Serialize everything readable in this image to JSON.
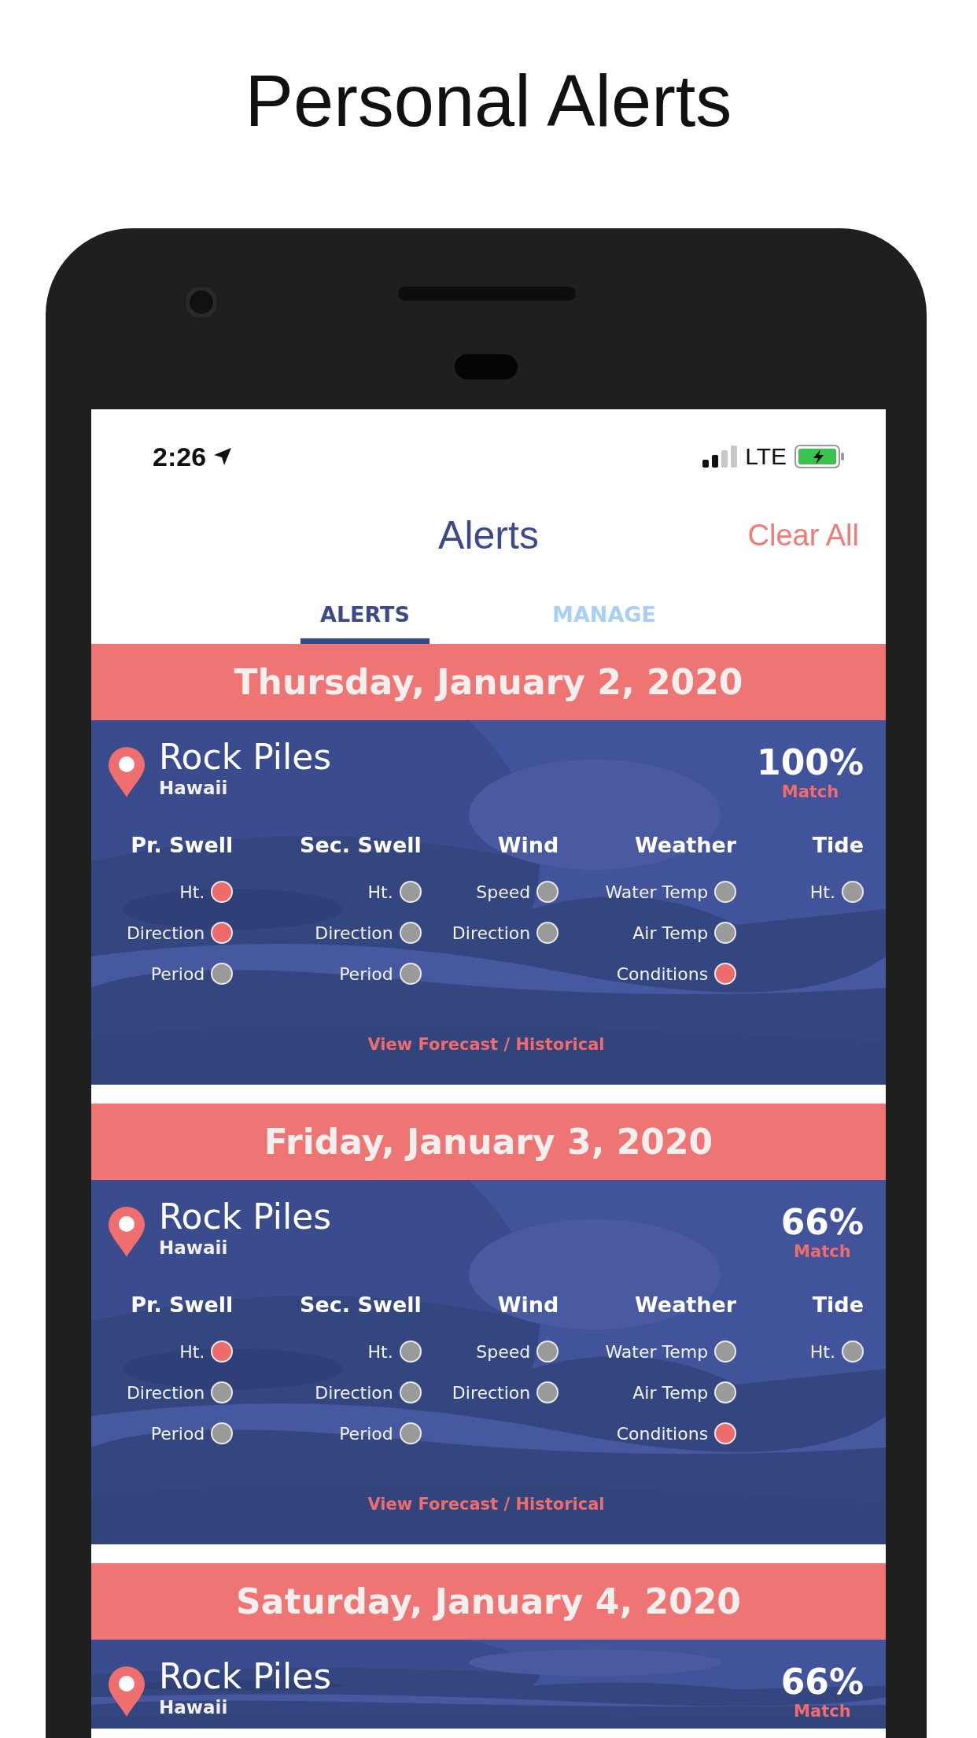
{
  "headline": "Personal Alerts",
  "status_bar": {
    "time": "2:26",
    "network": "LTE"
  },
  "header": {
    "title": "Alerts",
    "action": "Clear All"
  },
  "tabs": [
    {
      "label": "ALERTS",
      "selected": true
    },
    {
      "label": "MANAGE",
      "selected": false
    }
  ],
  "alerts": [
    {
      "date": "Thursday, January 2, 2020",
      "spot": "Rock Piles",
      "region": "Hawaii",
      "match": "100%",
      "match_label": "Match",
      "groups": [
        {
          "title": "Pr. Swell",
          "items": [
            {
              "label": "Ht.",
              "hit": true
            },
            {
              "label": "Direction",
              "hit": true
            },
            {
              "label": "Period",
              "hit": false
            }
          ]
        },
        {
          "title": "Sec. Swell",
          "items": [
            {
              "label": "Ht.",
              "hit": false
            },
            {
              "label": "Direction",
              "hit": false
            },
            {
              "label": "Period",
              "hit": false
            }
          ]
        },
        {
          "title": "Wind",
          "items": [
            {
              "label": "Speed",
              "hit": false
            },
            {
              "label": "Direction",
              "hit": false
            }
          ]
        },
        {
          "title": "Weather",
          "items": [
            {
              "label": "Water Temp",
              "hit": false
            },
            {
              "label": "Air Temp",
              "hit": false
            },
            {
              "label": "Conditions",
              "hit": true
            }
          ]
        },
        {
          "title": "Tide",
          "items": [
            {
              "label": "Ht.",
              "hit": false
            }
          ]
        }
      ],
      "link": "View Forecast / Historical"
    },
    {
      "date": "Friday, January 3, 2020",
      "spot": "Rock Piles",
      "region": "Hawaii",
      "match": "66%",
      "match_label": "Match",
      "groups": [
        {
          "title": "Pr. Swell",
          "items": [
            {
              "label": "Ht.",
              "hit": true
            },
            {
              "label": "Direction",
              "hit": false
            },
            {
              "label": "Period",
              "hit": false
            }
          ]
        },
        {
          "title": "Sec. Swell",
          "items": [
            {
              "label": "Ht.",
              "hit": false
            },
            {
              "label": "Direction",
              "hit": false
            },
            {
              "label": "Period",
              "hit": false
            }
          ]
        },
        {
          "title": "Wind",
          "items": [
            {
              "label": "Speed",
              "hit": false
            },
            {
              "label": "Direction",
              "hit": false
            }
          ]
        },
        {
          "title": "Weather",
          "items": [
            {
              "label": "Water Temp",
              "hit": false
            },
            {
              "label": "Air Temp",
              "hit": false
            },
            {
              "label": "Conditions",
              "hit": true
            }
          ]
        },
        {
          "title": "Tide",
          "items": [
            {
              "label": "Ht.",
              "hit": false
            }
          ]
        }
      ],
      "link": "View Forecast / Historical"
    },
    {
      "date": "Saturday, January 4, 2020",
      "spot": "Rock Piles",
      "region": "Hawaii",
      "match": "66%",
      "match_label": "Match"
    }
  ]
}
